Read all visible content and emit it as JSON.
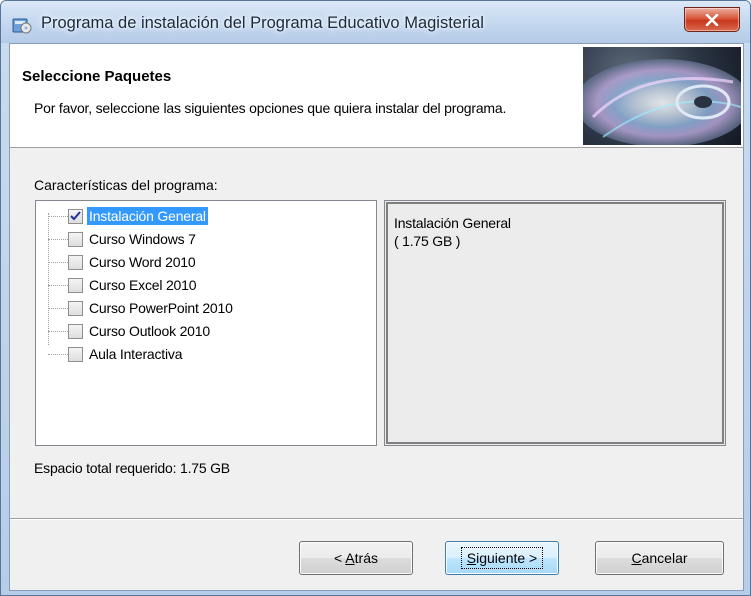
{
  "window": {
    "title": "Programa de instalación del Programa Educativo Magisterial"
  },
  "header": {
    "title": "Seleccione Paquetes",
    "subtitle": "Por favor, seleccione las siguientes opciones que quiera instalar del programa."
  },
  "features": {
    "label": "Características del programa:",
    "items": [
      {
        "label": "Instalación General",
        "checked": true,
        "selected": true
      },
      {
        "label": "Curso Windows 7",
        "checked": false,
        "selected": false
      },
      {
        "label": "Curso Word 2010",
        "checked": false,
        "selected": false
      },
      {
        "label": "Curso Excel 2010",
        "checked": false,
        "selected": false
      },
      {
        "label": "Curso PowerPoint 2010",
        "checked": false,
        "selected": false
      },
      {
        "label": "Curso Outlook 2010",
        "checked": false,
        "selected": false
      },
      {
        "label": "Aula Interactiva",
        "checked": false,
        "selected": false
      }
    ]
  },
  "description": {
    "name": "Instalación General",
    "size": "( 1.75 GB )"
  },
  "space": {
    "label": "Espacio total requerido: 1.75 GB"
  },
  "buttons": {
    "back": {
      "label": "< Atrás",
      "accel": "A"
    },
    "next": {
      "label": "Siguiente >",
      "accel": "S"
    },
    "cancel": {
      "label": "Cancelar",
      "accel": "C"
    }
  },
  "icons": {
    "app": "setup-icon",
    "close": "close-icon",
    "check": "checkmark-icon"
  },
  "colors": {
    "selection": "#3399ff",
    "close_button": "#c8381e",
    "focus_button": "#3c7fb1"
  }
}
